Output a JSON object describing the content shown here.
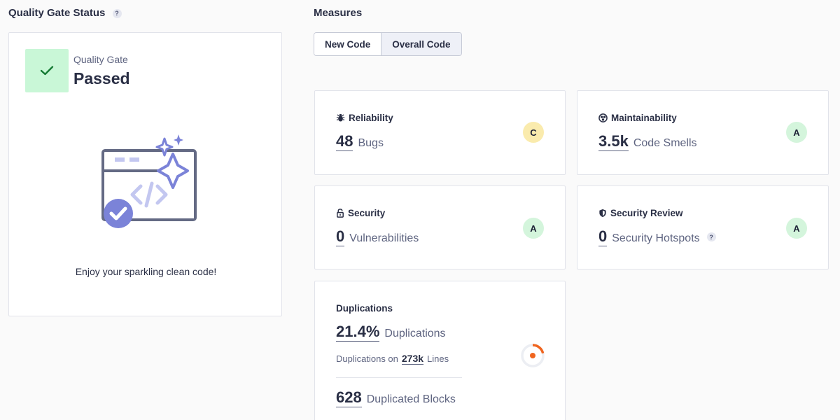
{
  "quality_gate": {
    "section_title": "Quality Gate Status",
    "help_glyph": "?",
    "label": "Quality Gate",
    "status": "Passed",
    "caption": "Enjoy your sparkling clean code!",
    "badge_color": "#c9f7d7"
  },
  "measures": {
    "section_title": "Measures",
    "tabs": [
      {
        "label": "New Code",
        "active": false
      },
      {
        "label": "Overall Code",
        "active": true
      }
    ],
    "reliability": {
      "title": "Reliability",
      "value": "48",
      "label": "Bugs",
      "rating": "C",
      "icon": "bug-icon"
    },
    "maintainability": {
      "title": "Maintainability",
      "value": "3.5k",
      "label": "Code Smells",
      "rating": "A",
      "icon": "smell-icon"
    },
    "security": {
      "title": "Security",
      "value": "0",
      "label": "Vulnerabilities",
      "rating": "A",
      "icon": "lock-icon"
    },
    "security_review": {
      "title": "Security Review",
      "value": "0",
      "label": "Security Hotspots",
      "rating": "A",
      "icon": "shield-icon",
      "help_glyph": "?"
    },
    "duplications": {
      "title": "Duplications",
      "value": "21.4%",
      "label": "Duplications",
      "lines_prefix": "Duplications on",
      "lines_value": "273k",
      "lines_suffix": "Lines",
      "blocks_value": "628",
      "blocks_label": "Duplicated Blocks",
      "ring_fraction": 0.214,
      "ring_color": "#f0651f"
    }
  },
  "colors": {
    "rating_a": "#d4f5dc",
    "rating_c": "#faebad",
    "accent": "#7b83d8"
  }
}
